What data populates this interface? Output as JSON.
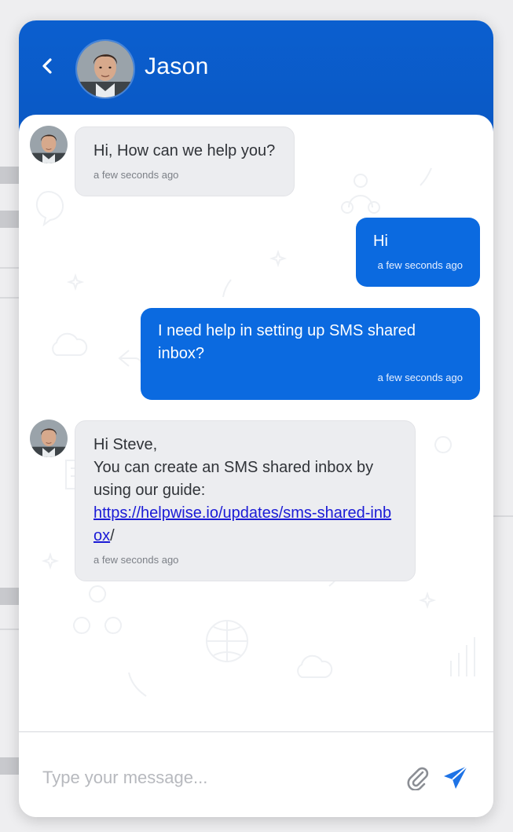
{
  "header": {
    "back_icon": "chevron-left-icon",
    "contact_name": "Jason"
  },
  "messages": [
    {
      "direction": "incoming",
      "text": "Hi, How can we help you?",
      "time": "a few seconds ago"
    },
    {
      "direction": "outgoing",
      "text": "Hi",
      "time": "a few seconds ago"
    },
    {
      "direction": "outgoing",
      "text": "I need help in setting up SMS shared inbox?",
      "time": "a few seconds ago"
    },
    {
      "direction": "incoming",
      "line1": "Hi Steve,",
      "line2": "You can create an SMS shared inbox by using our guide:",
      "link_text": "https://helpwise.io/updates/sms-shared-inbox",
      "link_suffix": "/",
      "time": "a few seconds ago"
    }
  ],
  "composer": {
    "placeholder": "Type your message...",
    "attach_icon": "paperclip-icon",
    "send_icon": "send-icon"
  },
  "colors": {
    "header_blue": "#0b5fcf",
    "outgoing_bubble": "#0b6ae0",
    "incoming_bubble": "#ecedf0",
    "link": "#1a1ad6"
  }
}
